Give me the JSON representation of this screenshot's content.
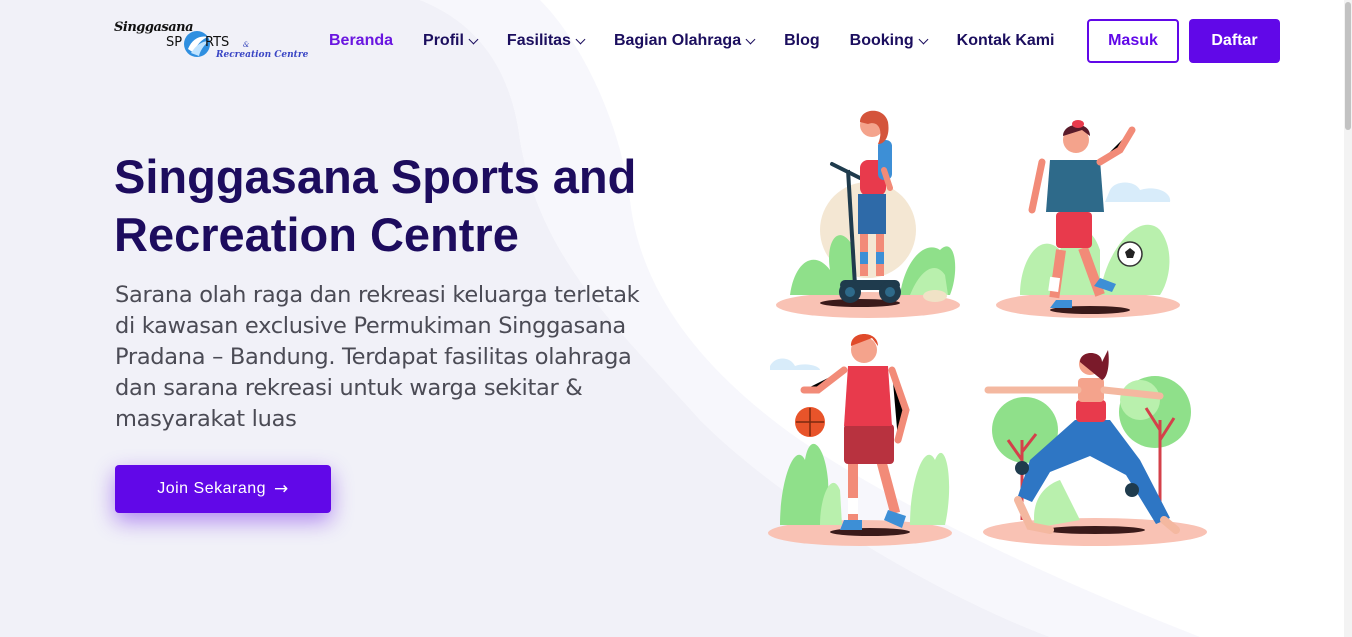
{
  "brand": {
    "line1": "Singgasana",
    "line2a": "SP",
    "line2b": "RTS",
    "amp": "&",
    "line3": "Recreation Centre"
  },
  "nav": {
    "items": [
      {
        "label": "Beranda",
        "dropdown": false,
        "active": true
      },
      {
        "label": "Profil",
        "dropdown": true,
        "active": false
      },
      {
        "label": "Fasilitas",
        "dropdown": true,
        "active": false
      },
      {
        "label": "Bagian Olahraga",
        "dropdown": true,
        "active": false
      },
      {
        "label": "Blog",
        "dropdown": false,
        "active": false
      },
      {
        "label": "Booking",
        "dropdown": true,
        "active": false
      },
      {
        "label": "Kontak Kami",
        "dropdown": false,
        "active": false
      }
    ],
    "login_label": "Masuk",
    "register_label": "Daftar"
  },
  "hero": {
    "title": "Singgasana Sports and Recreation Centre",
    "description": "Sarana olah raga dan rekreasi keluarga terletak di kawasan exclusive Permukiman Singgasana Pradana – Bandung. Terdapat fasilitas olahraga dan sarana rekreasi untuk warga sekitar & masyarakat luas",
    "cta_label": "Join Sekarang",
    "cta_icon": "arrow-right-icon"
  },
  "colors": {
    "primary": "#6108e8",
    "heading": "#1d0c5e",
    "active_nav": "#6a16e0",
    "body_text": "#4b4b55",
    "background_wave": "#f4f4fb"
  }
}
